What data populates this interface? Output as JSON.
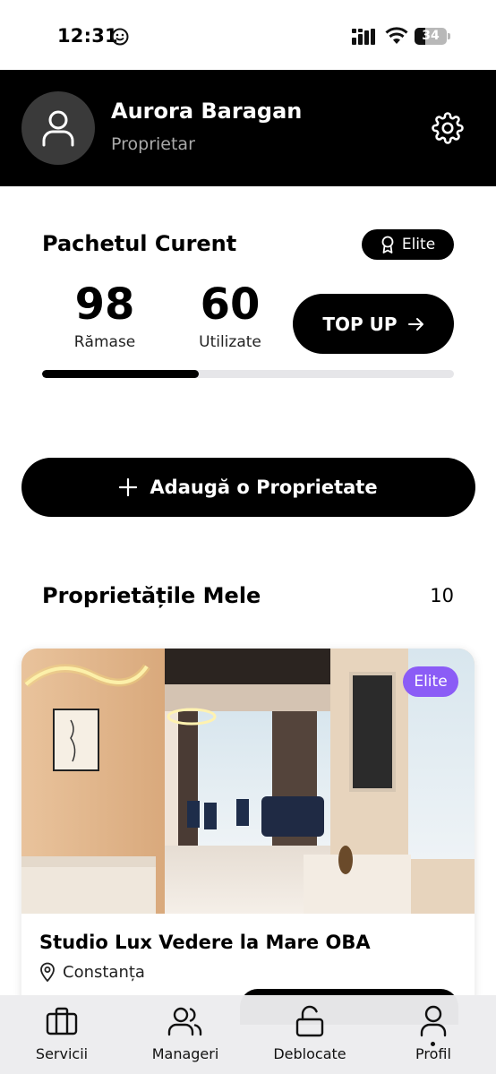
{
  "status_bar": {
    "time": "12:31",
    "battery": "34"
  },
  "header": {
    "user_name": "Aurora Baragan",
    "user_role": "Proprietar"
  },
  "package": {
    "title": "Pachetul Curent",
    "tier": "Elite",
    "remaining_value": "98",
    "remaining_label": "Rămase",
    "used_value": "60",
    "used_label": "Utilizate",
    "topup_label": "TOP UP",
    "usage_fraction": 0.38
  },
  "add_property_label": "Adaugă o Proprietate",
  "properties": {
    "title": "Proprietățile Mele",
    "count": "10",
    "items": [
      {
        "name": "Studio Lux Vedere la Mare OBA",
        "location": "Constanța",
        "badge": "Elite"
      }
    ]
  },
  "bottom_nav": [
    {
      "label": "Servicii",
      "icon": "briefcase-icon"
    },
    {
      "label": "Manageri",
      "icon": "users-icon"
    },
    {
      "label": "Deblocate",
      "icon": "unlock-icon"
    },
    {
      "label": "Profil",
      "icon": "user-icon"
    }
  ],
  "colors": {
    "accent": "#000000",
    "elite_badge": "#8b5cf6",
    "header_bg": "#000000"
  }
}
